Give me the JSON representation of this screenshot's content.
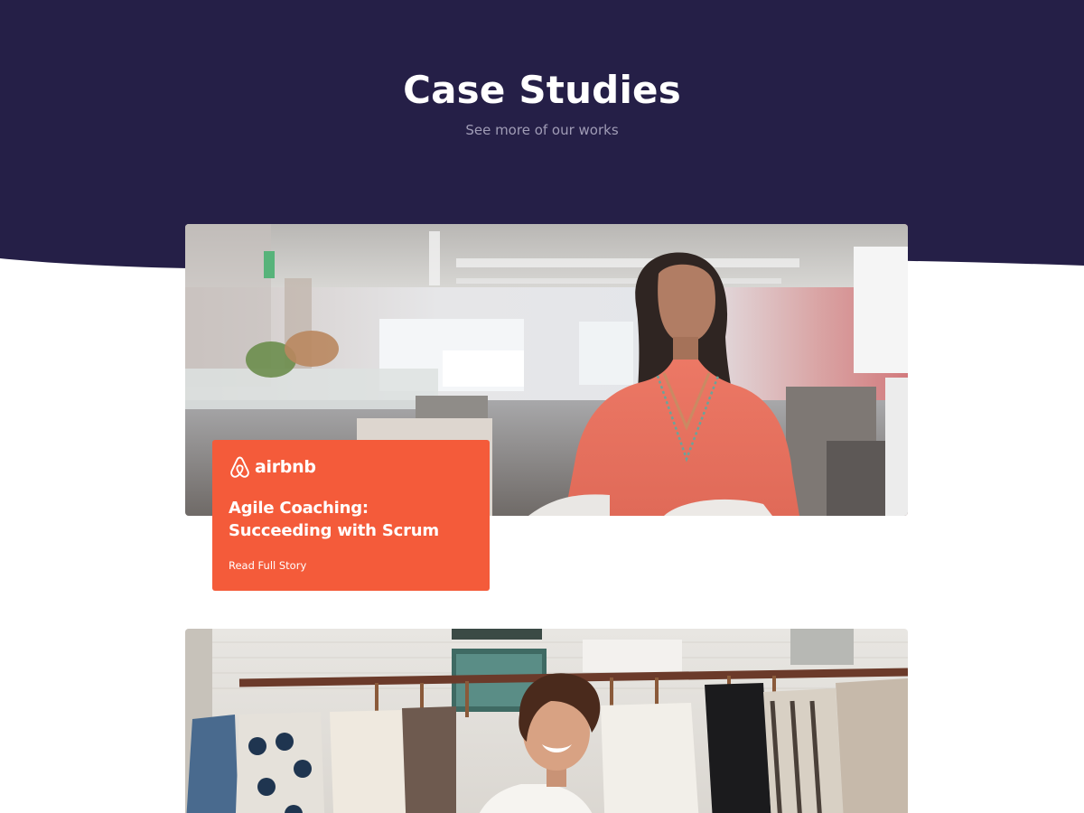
{
  "colors": {
    "hero_background": "#251f47",
    "accent": "#f45b3a",
    "subtitle": "#a09cb6",
    "page_background": "#ffffff"
  },
  "hero": {
    "title": "Case Studies",
    "subtitle": "See more of our works"
  },
  "case_studies": [
    {
      "brand": {
        "name": "airbnb",
        "icon": "airbnb-logo-icon"
      },
      "title": "Agile Coaching: Succeeding with Scrum",
      "link_label": "Read Full Story",
      "image": "woman-in-office-photo"
    },
    {
      "image": "woman-at-clothing-rack-photo"
    }
  ]
}
